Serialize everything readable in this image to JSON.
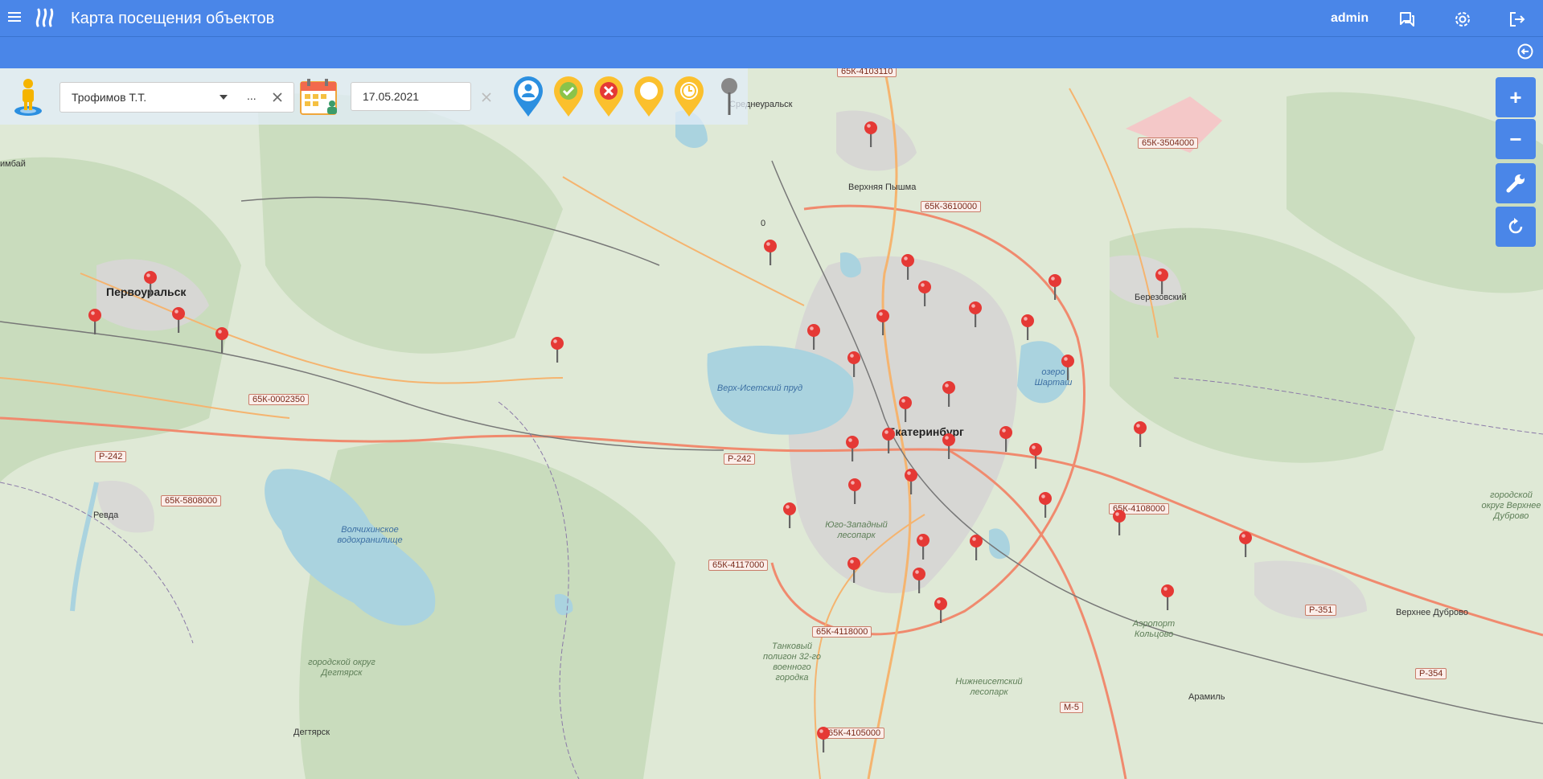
{
  "header": {
    "title": "Карта посещения объектов",
    "user": "admin",
    "help_icon": "help-icon",
    "settings_icon": "gear-icon",
    "logout_icon": "logout-icon",
    "menu_icon": "hamburger-icon",
    "logo_icon": "steam-logo-icon"
  },
  "filter": {
    "employee_value": "Трофимов Т.Т.",
    "more_label": "...",
    "date_value": "17.05.2021",
    "marker_filters": [
      "person-marker-icon",
      "check-marker-icon",
      "cross-marker-icon",
      "empty-marker-icon",
      "clock-marker-icon",
      "grey-pin-icon"
    ]
  },
  "map_controls": {
    "zoom_in": "+",
    "zoom_out": "−"
  },
  "colors": {
    "header": "#4a86e8",
    "pin": "#e53935",
    "blue_marker": "#2b8fe0",
    "green_marker": "#8bc34a",
    "yellow_marker": "#fbc02d",
    "red_marker": "#e53935"
  },
  "map": {
    "cities": [
      {
        "id": "pervouralsk",
        "name": "Первоуральск"
      },
      {
        "id": "ekb",
        "name": "Екатеринбург"
      },
      {
        "id": "v_pyshma",
        "name": "Верхняя Пышма"
      },
      {
        "id": "berezovsky",
        "name": "Березовский"
      },
      {
        "id": "revda",
        "name": "Ревда"
      },
      {
        "id": "v_dubrovo",
        "name": "Верхнее Дуброво"
      },
      {
        "id": "aramil",
        "name": "Арамиль"
      },
      {
        "id": "degtyarsk",
        "name": "Дегтярск"
      },
      {
        "id": "sredneuralsk",
        "name": "Среднеуральск"
      },
      {
        "id": "bilimbay",
        "name": "имбай"
      }
    ],
    "roads": [
      "65К-4103110",
      "65К-3504000",
      "65К-3610000",
      "65К-0002350",
      "Р-242",
      "Р-242",
      "65К-5808000",
      "65К-4108000",
      "65К-4117000",
      "65К-4118000",
      "Р-351",
      "Р-354",
      "М-5",
      "65К-4105000"
    ],
    "water": [
      "Верх-Исетский пруд",
      "озеро Шарташ",
      "Волчихинское водохранилище"
    ],
    "areas": [
      "Юго-Западный лесопарк",
      "Нижнеисетский лесопарк",
      "Танковый полигон 32-го военного городка",
      "городской округ Дегтярск",
      "городской округ Верхнее Дуброво",
      "Аэропорт Кольцово"
    ],
    "misc_label": "0",
    "pin_count": 38
  }
}
